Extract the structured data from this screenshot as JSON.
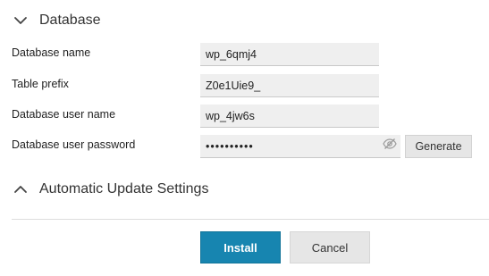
{
  "database_section": {
    "title": "Database",
    "expanded": true
  },
  "fields": {
    "db_name": {
      "label": "Database name",
      "value": "wp_6qmj4"
    },
    "table_prefix": {
      "label": "Table prefix",
      "value": "Z0e1Uie9_"
    },
    "db_user": {
      "label": "Database user name",
      "value": "wp_4jw6s"
    },
    "db_password": {
      "label": "Database user password",
      "value": "••••••••••"
    }
  },
  "generate_label": "Generate",
  "auto_update_section": {
    "title": "Automatic Update Settings",
    "expanded": false
  },
  "actions": {
    "install_label": "Install",
    "cancel_label": "Cancel"
  },
  "colors": {
    "primary": "#1785b0",
    "input_bg": "#efefef",
    "secondary_button": "#e6e6e6"
  },
  "icons": {
    "db_toggle": "chevron-down-icon",
    "auto_update_toggle": "chevron-up-icon",
    "password_visibility": "eye-slash-icon"
  }
}
